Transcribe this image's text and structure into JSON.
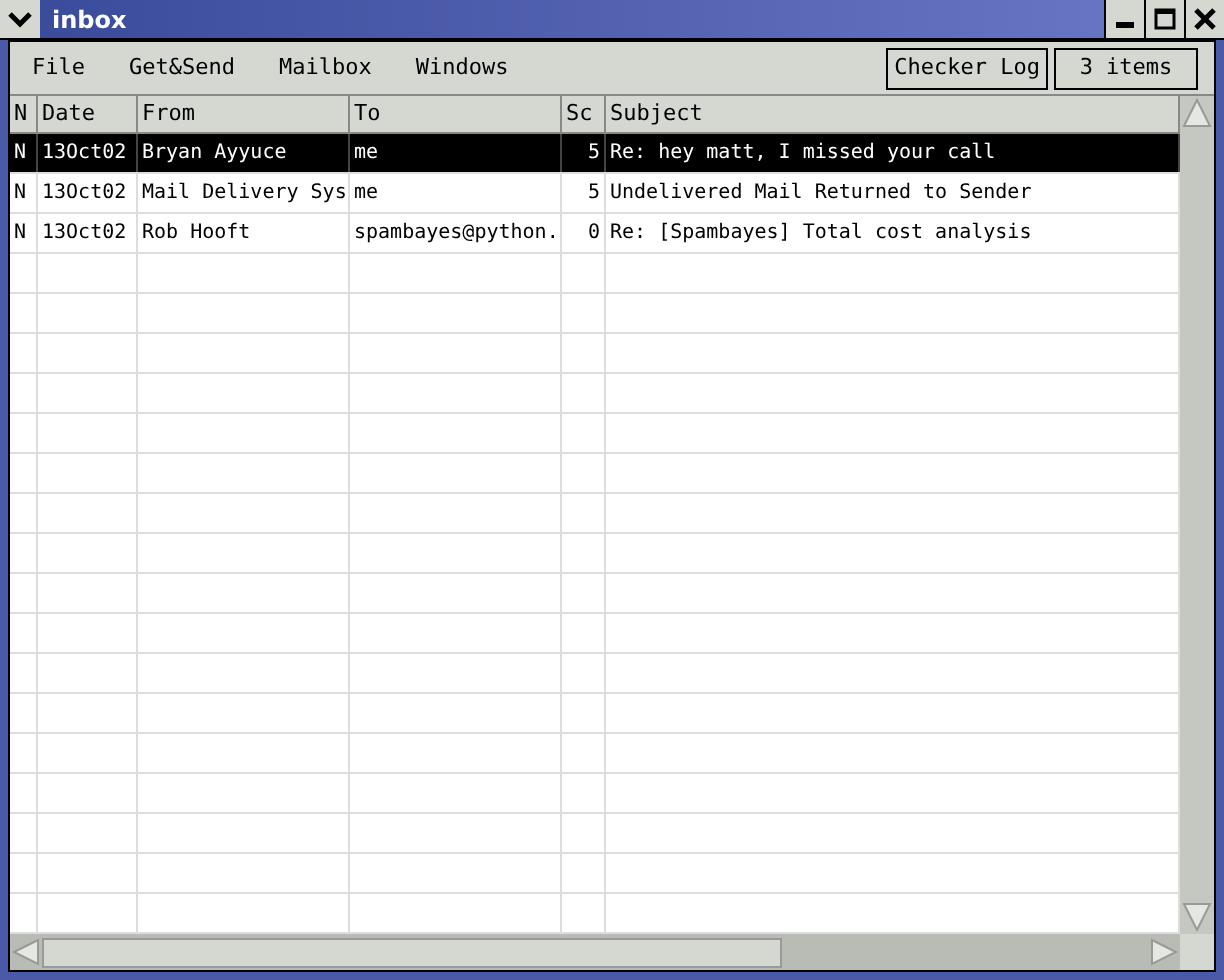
{
  "window": {
    "title": "inbox"
  },
  "menu": [
    "File",
    "Get&Send",
    "Mailbox",
    "Windows"
  ],
  "buttons": [
    "Checker Log"
  ],
  "item_count": "3 items",
  "table": {
    "columns": [
      "N",
      "Date",
      "From",
      "To",
      "Sc",
      "Subject"
    ],
    "rows": [
      {
        "cells": [
          "N",
          "13Oct02",
          "Bryan Ayyuce",
          "me",
          "5",
          "Re: hey matt, I missed your call"
        ],
        "selected": true
      },
      {
        "cells": [
          "N",
          "13Oct02",
          "Mail Delivery Sys",
          "me",
          "5",
          "Undelivered Mail Returned to Sender"
        ],
        "selected": false
      },
      {
        "cells": [
          "N",
          "13Oct02",
          "Rob Hooft",
          "spambayes@python.",
          "0",
          "Re: [Spambayes] Total cost analysis"
        ],
        "selected": false
      }
    ]
  }
}
